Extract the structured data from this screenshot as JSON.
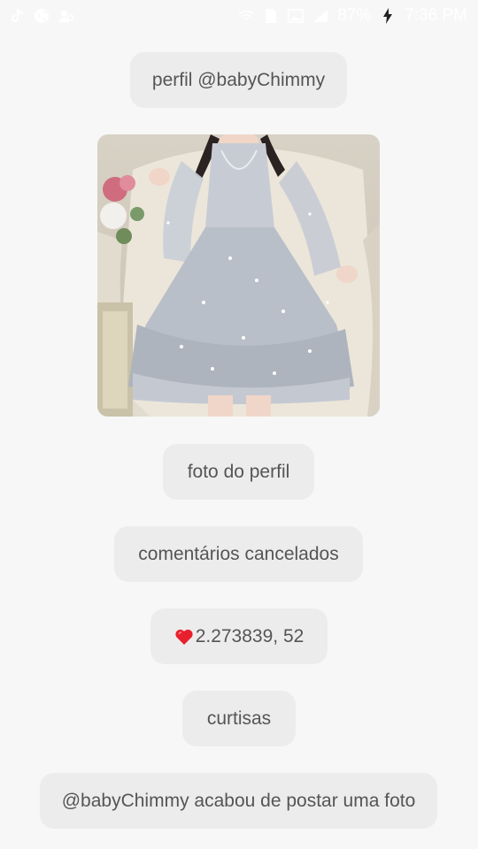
{
  "status_bar": {
    "left_icons": [
      "tiktok-icon",
      "globe-icon",
      "people-icon"
    ],
    "right_icons": [
      "wifi-icon",
      "sim-icon",
      "photo-icon",
      "signal-icon",
      "charging-icon"
    ],
    "battery": "87%",
    "time": "7:36 PM"
  },
  "profile": {
    "title": "perfil @babyChimmy",
    "photo_label": "foto do perfil",
    "comments_status": "comentários cancelados",
    "likes": "2.273839, 52",
    "likes_icon": "heart-icon",
    "likes_label": "curtisas",
    "notification": "@babyChimmy acabou de postar uma foto"
  },
  "colors": {
    "background": "#f7f7f7",
    "bubble": "#ececec",
    "text": "#555555",
    "heart": "#e8202e"
  }
}
